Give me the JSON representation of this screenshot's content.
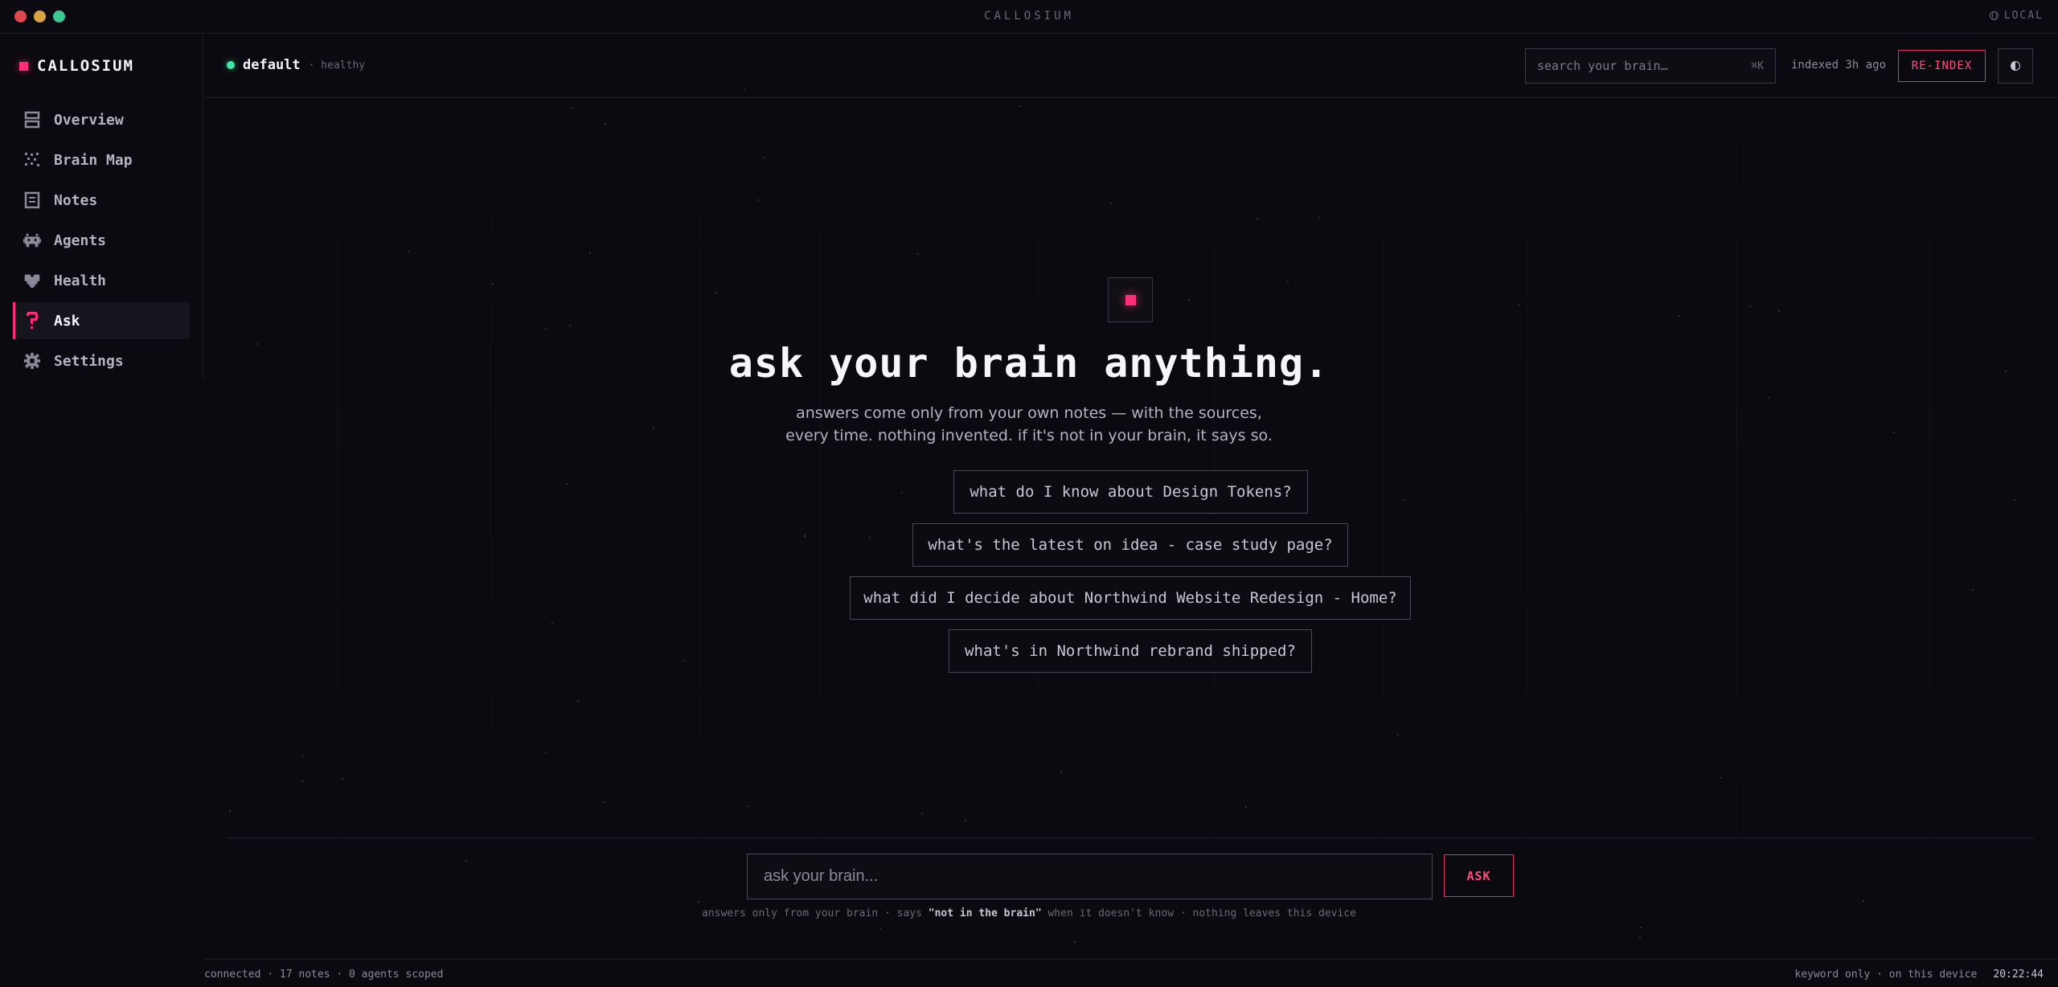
{
  "window": {
    "title": "CALLOSIUM",
    "mode_label": "LOCAL"
  },
  "sidebar": {
    "brand": "CALLOSIUM",
    "items": [
      {
        "label": "Overview",
        "icon": "overview-icon"
      },
      {
        "label": "Brain Map",
        "icon": "brain-map-icon"
      },
      {
        "label": "Notes",
        "icon": "notes-icon"
      },
      {
        "label": "Agents",
        "icon": "agents-icon"
      },
      {
        "label": "Health",
        "icon": "heart-icon"
      },
      {
        "label": "Ask",
        "icon": "question-icon",
        "active": true
      },
      {
        "label": "Settings",
        "icon": "gear-icon"
      }
    ]
  },
  "header": {
    "brain_name": "default",
    "brain_health": "· healthy",
    "search_placeholder": "search your brain…",
    "search_shortcut": "⌘K",
    "indexed_label": "indexed 3h ago",
    "reindex_label": "RE-INDEX"
  },
  "hero": {
    "title": "ask your brain anything.",
    "subtitle_line1": "answers come only from your own notes — with the sources,",
    "subtitle_line2": "every time. nothing invented. if it's not in your brain, it says so.",
    "suggestions": [
      "what do I know about Design Tokens?",
      "what's the latest on idea - case study page?",
      "what did I decide about Northwind Website Redesign - Home?",
      "what's in Northwind rebrand shipped?"
    ]
  },
  "ask": {
    "placeholder": "ask your brain...",
    "button_label": "ASK",
    "note_prefix": "answers only from your brain · says ",
    "note_quote": "\"not in the brain\"",
    "note_suffix": " when it doesn't know · nothing leaves this device"
  },
  "footer": {
    "left": "connected · 17 notes · 0 agents scoped",
    "mode": "keyword only · on this device",
    "clock": "20:22:44"
  },
  "colors": {
    "accent": "#ff2e78",
    "healthy": "#3ee6a8",
    "background": "#0b0a10"
  }
}
